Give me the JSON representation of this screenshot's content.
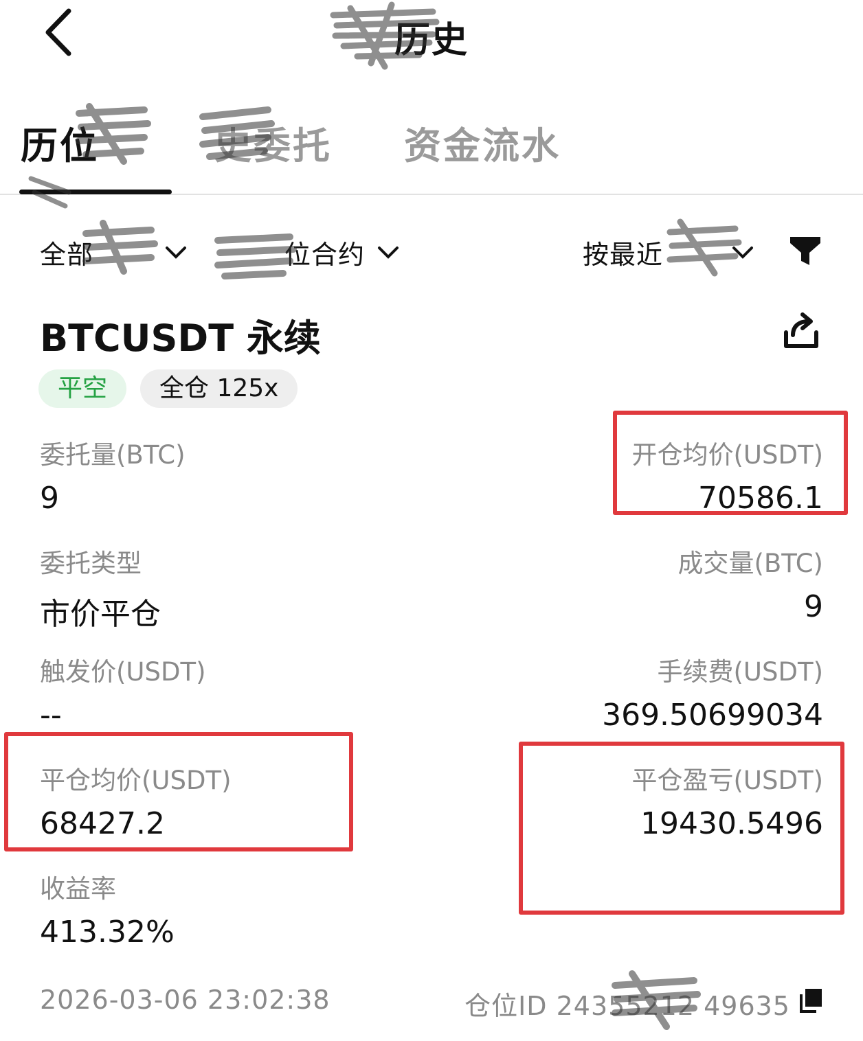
{
  "header": {
    "title": "历史",
    "back_icon": "chevron-left-icon"
  },
  "tabs": [
    {
      "label": "历位",
      "active": true
    },
    {
      "label": "史委托",
      "active": false
    },
    {
      "label": "资金流水",
      "active": false
    }
  ],
  "filters": {
    "filter1": "全部",
    "filter2": "位合约",
    "sort": "按最近",
    "filter_icon": "funnel-icon"
  },
  "position": {
    "symbol": "BTCUSDT 永续",
    "share_icon": "share-icon",
    "side_tag": "平空",
    "mode_tag": "全仓 125x",
    "fields": {
      "order_qty_label": "委托量(BTC)",
      "order_qty_value": "9",
      "open_avg_label": "开仓均价(USDT)",
      "open_avg_value": "70586.1",
      "order_type_label": "委托类型",
      "order_type_value": "市价平仓",
      "filled_qty_label": "成交量(BTC)",
      "filled_qty_value": "9",
      "trigger_price_label": "触发价(USDT)",
      "trigger_price_value": "--",
      "fee_label": "手续费(USDT)",
      "fee_value": "369.50699034",
      "close_avg_label": "平仓均价(USDT)",
      "close_avg_value": "68427.2",
      "pnl_label": "平仓盈亏(USDT)",
      "pnl_value": "19430.5496",
      "roi_label": "收益率",
      "roi_value": "413.32%"
    },
    "timestamp": "2026-03-06 23:02:38",
    "position_id": "仓位ID 24355212 49635",
    "copy_icon": "copy-icon"
  },
  "colors": {
    "highlight": "#e0393d",
    "side_tag_text": "#25a244",
    "side_tag_bg": "#e6f6ea",
    "muted_text": "#8a8a8a"
  }
}
